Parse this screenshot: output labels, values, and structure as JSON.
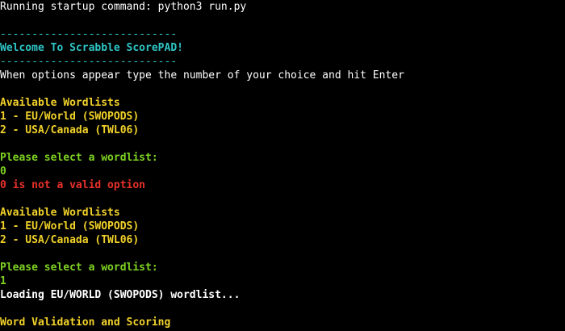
{
  "colors": {
    "background": "#000000",
    "default_text": "#ffffff",
    "banner": "#2fc6c6",
    "heading": "#f2d22a",
    "prompt": "#7ed321",
    "error": "#e8312b"
  },
  "terminal": {
    "lines": [
      "Running startup command: python3 run.py",
      "",
      "----------------------------",
      "Welcome To Scrabble ScorePAD!",
      "----------------------------",
      "When options appear type the number of your choice and hit Enter",
      "",
      "Available Wordlists",
      "1 - EU/World (SWOPODS)",
      "2 - USA/Canada (TWL06)",
      "",
      "Please select a wordlist:",
      "0",
      "0 is not a valid option",
      "",
      "Available Wordlists",
      "1 - EU/World (SWOPODS)",
      "2 - USA/Canada (TWL06)",
      "",
      "Please select a wordlist:",
      "1",
      "Loading EU/WORLD (SWOPODS) wordlist...",
      "",
      "Word Validation and Scoring"
    ]
  }
}
